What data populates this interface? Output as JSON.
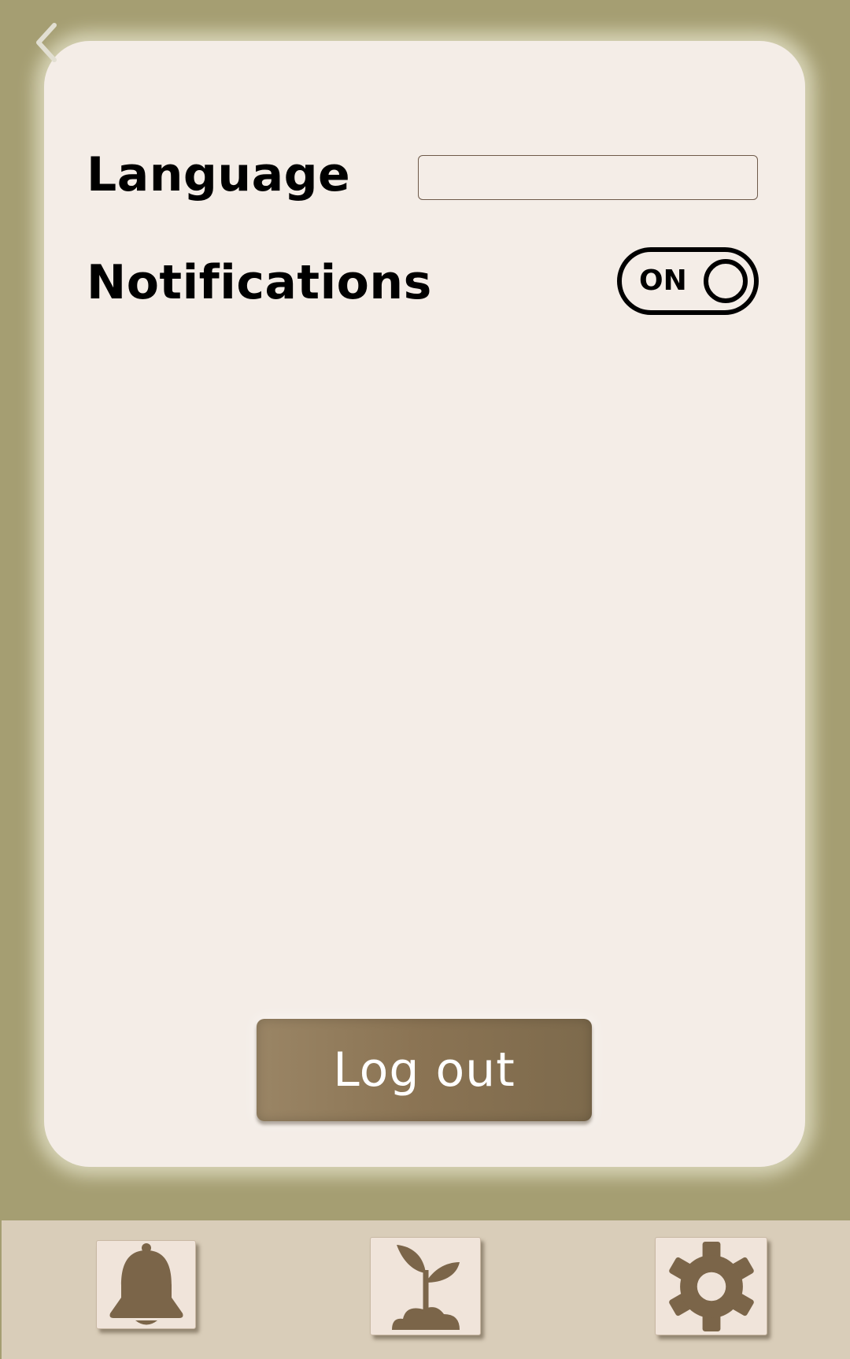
{
  "header": {
    "back_icon": "chevron-left-icon"
  },
  "settings": {
    "language_label": "Language",
    "language_value": "",
    "language_placeholder": "",
    "notifications_label": "Notifications",
    "notifications_toggle_text": "ON",
    "notifications_enabled": true
  },
  "actions": {
    "logout_label": "Log out"
  },
  "bottom_nav": {
    "items": [
      {
        "icon": "bell-icon"
      },
      {
        "icon": "sprout-icon"
      },
      {
        "icon": "gear-icon"
      }
    ]
  },
  "colors": {
    "background": "#a59e72",
    "card": "#f4ede7",
    "accent_brown": "#7b6549",
    "nav_bar": "#d9cdb9",
    "nav_button": "#f0e4da",
    "back_chevron": "#e2dfd2"
  }
}
